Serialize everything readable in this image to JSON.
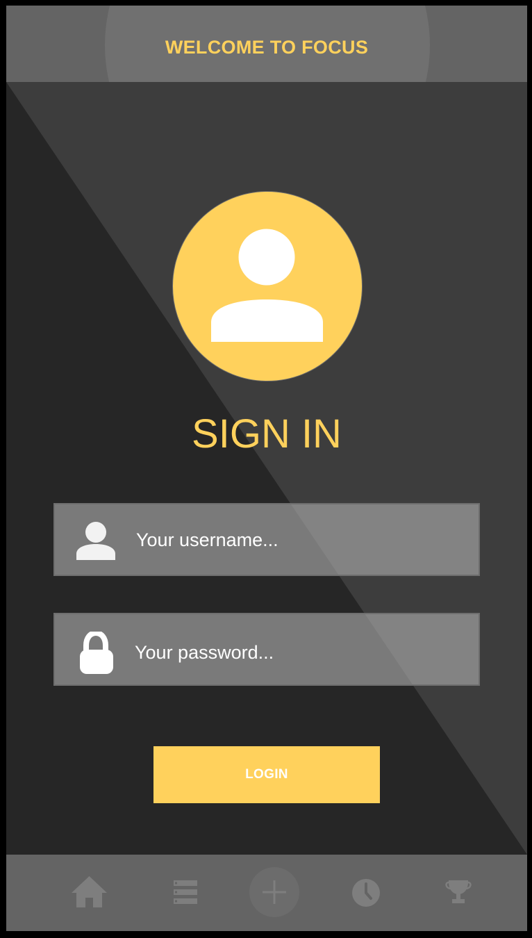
{
  "header": {
    "title": "WELCOME TO FOCUS"
  },
  "signin": {
    "title": "SIGN IN"
  },
  "form": {
    "username_placeholder": "Your username...",
    "password_placeholder": "Your password...",
    "login_label": "LOGIN"
  },
  "tabbar": {
    "items": [
      {
        "icon": "home-icon"
      },
      {
        "icon": "list-icon"
      },
      {
        "icon": "plus-icon"
      },
      {
        "icon": "clock-icon"
      },
      {
        "icon": "trophy-icon"
      }
    ]
  },
  "colors": {
    "accent": "#ffd15c",
    "background": "#3d3d3d",
    "diagonal_shadow": "#262626",
    "bar": "#646464",
    "icon_muted": "#7e7e7e"
  }
}
